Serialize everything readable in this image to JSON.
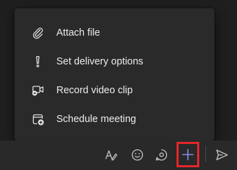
{
  "menu": {
    "items": [
      {
        "label": "Attach file",
        "icon": "paperclip-icon"
      },
      {
        "label": "Set delivery options",
        "icon": "exclamation-icon"
      },
      {
        "label": "Record video clip",
        "icon": "video-clip-icon"
      },
      {
        "label": "Schedule meeting",
        "icon": "calendar-add-icon"
      }
    ]
  },
  "compose_bar": {
    "tools": [
      {
        "icon": "format-icon"
      },
      {
        "icon": "emoji-icon"
      },
      {
        "icon": "loop-icon"
      },
      {
        "icon": "plus-icon",
        "highlighted": true
      },
      {
        "icon": "send-icon"
      }
    ]
  },
  "colors": {
    "background": "#1f1f1f",
    "menu_background": "#2a2a2a",
    "text": "#ededed",
    "accent": "#7f85f5",
    "highlight_border": "#e8262b"
  }
}
